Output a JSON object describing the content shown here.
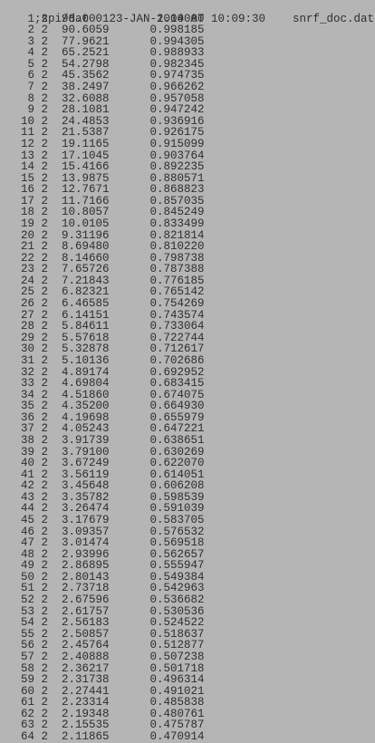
{
  "header": {
    "command": ";spi/dat",
    "timestamp": "23-JAN-2014 AT 10:09:30",
    "filename": "snrf_doc.dat"
  },
  "rows": [
    [
      "1",
      "2",
      "98.0001",
      "1.00000"
    ],
    [
      "2",
      "2",
      "90.6059",
      "0.998185"
    ],
    [
      "3",
      "2",
      "77.9621",
      "0.994305"
    ],
    [
      "4",
      "2",
      "65.2521",
      "0.988933"
    ],
    [
      "5",
      "2",
      "54.2798",
      "0.982345"
    ],
    [
      "6",
      "2",
      "45.3562",
      "0.974735"
    ],
    [
      "7",
      "2",
      "38.2497",
      "0.966262"
    ],
    [
      "8",
      "2",
      "32.6088",
      "0.957058"
    ],
    [
      "9",
      "2",
      "28.1081",
      "0.947242"
    ],
    [
      "10",
      "2",
      "24.4853",
      "0.936916"
    ],
    [
      "11",
      "2",
      "21.5387",
      "0.926175"
    ],
    [
      "12",
      "2",
      "19.1165",
      "0.915099"
    ],
    [
      "13",
      "2",
      "17.1045",
      "0.903764"
    ],
    [
      "14",
      "2",
      "15.4166",
      "0.892235"
    ],
    [
      "15",
      "2",
      "13.9875",
      "0.880571"
    ],
    [
      "16",
      "2",
      "12.7671",
      "0.868823"
    ],
    [
      "17",
      "2",
      "11.7166",
      "0.857035"
    ],
    [
      "18",
      "2",
      "10.8057",
      "0.845249"
    ],
    [
      "19",
      "2",
      "10.0105",
      "0.833499"
    ],
    [
      "20",
      "2",
      "9.31196",
      "0.821814"
    ],
    [
      "21",
      "2",
      "8.69480",
      "0.810220"
    ],
    [
      "22",
      "2",
      "8.14660",
      "0.798738"
    ],
    [
      "23",
      "2",
      "7.65726",
      "0.787388"
    ],
    [
      "24",
      "2",
      "7.21843",
      "0.776185"
    ],
    [
      "25",
      "2",
      "6.82321",
      "0.765142"
    ],
    [
      "26",
      "2",
      "6.46585",
      "0.754269"
    ],
    [
      "27",
      "2",
      "6.14151",
      "0.743574"
    ],
    [
      "28",
      "2",
      "5.84611",
      "0.733064"
    ],
    [
      "29",
      "2",
      "5.57618",
      "0.722744"
    ],
    [
      "30",
      "2",
      "5.32878",
      "0.712617"
    ],
    [
      "31",
      "2",
      "5.10136",
      "0.702686"
    ],
    [
      "32",
      "2",
      "4.89174",
      "0.692952"
    ],
    [
      "33",
      "2",
      "4.69804",
      "0.683415"
    ],
    [
      "34",
      "2",
      "4.51860",
      "0.674075"
    ],
    [
      "35",
      "2",
      "4.35200",
      "0.664930"
    ],
    [
      "36",
      "2",
      "4.19698",
      "0.655979"
    ],
    [
      "37",
      "2",
      "4.05243",
      "0.647221"
    ],
    [
      "38",
      "2",
      "3.91739",
      "0.638651"
    ],
    [
      "39",
      "2",
      "3.79100",
      "0.630269"
    ],
    [
      "40",
      "2",
      "3.67249",
      "0.622070"
    ],
    [
      "41",
      "2",
      "3.56119",
      "0.614051"
    ],
    [
      "42",
      "2",
      "3.45648",
      "0.606208"
    ],
    [
      "43",
      "2",
      "3.35782",
      "0.598539"
    ],
    [
      "44",
      "2",
      "3.26474",
      "0.591039"
    ],
    [
      "45",
      "2",
      "3.17679",
      "0.583705"
    ],
    [
      "46",
      "2",
      "3.09357",
      "0.576532"
    ],
    [
      "47",
      "2",
      "3.01474",
      "0.569518"
    ],
    [
      "48",
      "2",
      "2.93996",
      "0.562657"
    ],
    [
      "49",
      "2",
      "2.86895",
      "0.555947"
    ],
    [
      "50",
      "2",
      "2.80143",
      "0.549384"
    ],
    [
      "51",
      "2",
      "2.73718",
      "0.542963"
    ],
    [
      "52",
      "2",
      "2.67596",
      "0.536682"
    ],
    [
      "53",
      "2",
      "2.61757",
      "0.530536"
    ],
    [
      "54",
      "2",
      "2.56183",
      "0.524522"
    ],
    [
      "55",
      "2",
      "2.50857",
      "0.518637"
    ],
    [
      "56",
      "2",
      "2.45764",
      "0.512877"
    ],
    [
      "57",
      "2",
      "2.40888",
      "0.507238"
    ],
    [
      "58",
      "2",
      "2.36217",
      "0.501718"
    ],
    [
      "59",
      "2",
      "2.31738",
      "0.496314"
    ],
    [
      "60",
      "2",
      "2.27441",
      "0.491021"
    ],
    [
      "61",
      "2",
      "2.23314",
      "0.485838"
    ],
    [
      "62",
      "2",
      "2.19348",
      "0.480761"
    ],
    [
      "63",
      "2",
      "2.15535",
      "0.475787"
    ],
    [
      "64",
      "2",
      "2.11865",
      "0.470914"
    ]
  ]
}
